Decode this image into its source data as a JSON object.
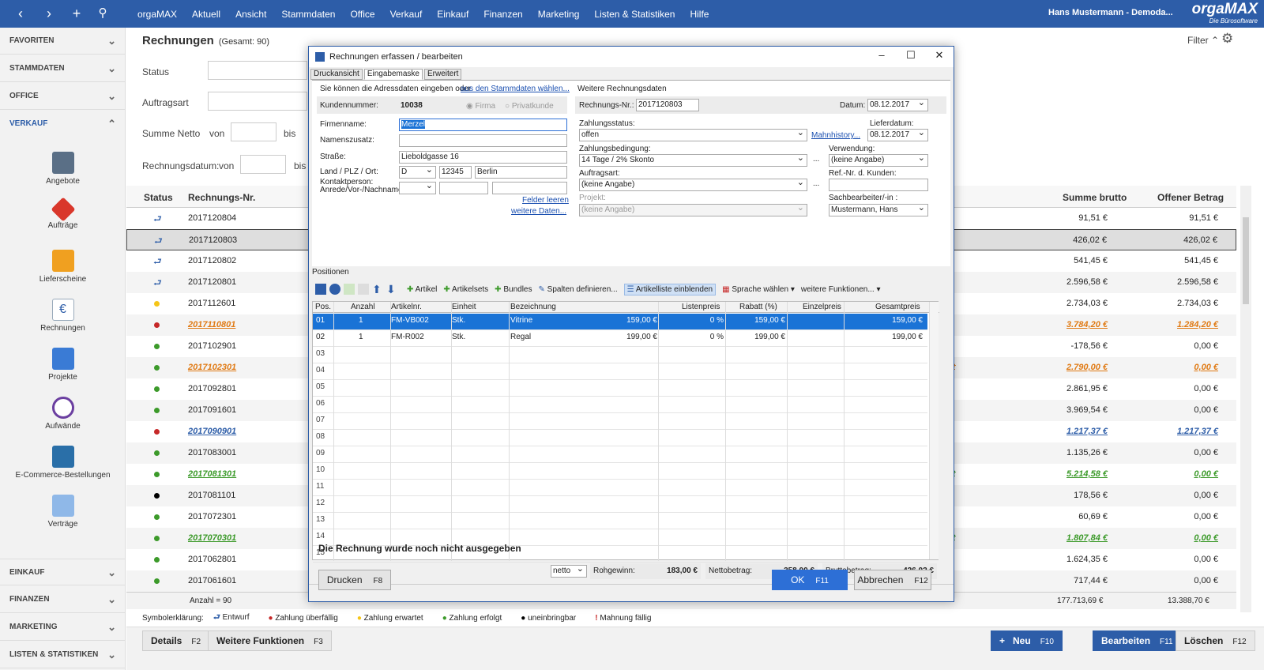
{
  "top": {
    "app": "orgaMAX",
    "menu": [
      "Aktuell",
      "Ansicht",
      "Stammdaten",
      "Office",
      "Verkauf",
      "Einkauf",
      "Finanzen",
      "Marketing",
      "Listen & Statistiken",
      "Hilfe"
    ],
    "user": "Hans Mustermann - Demoda...",
    "logo": "orgaMAX",
    "logo_sub": "Die Bürosoftware"
  },
  "sidebar": {
    "sections": [
      "FAVORITEN",
      "STAMMDATEN",
      "OFFICE",
      "VERKAUF"
    ],
    "items": [
      "Angebote",
      "Aufträge",
      "Lieferscheine",
      "Rechnungen",
      "Projekte",
      "Aufwände",
      "E-Commerce-Bestellungen",
      "Verträge"
    ],
    "bottom_sections": [
      "EINKAUF",
      "FINANZEN",
      "MARKETING",
      "LISTEN & STATISTIKEN"
    ]
  },
  "page": {
    "title": "Rechnungen",
    "count": "(Gesamt: 90)",
    "filter_label": "Filter",
    "f_status": "Status",
    "f_auftragsart": "Auftragsart",
    "f_summe": "Summe Netto",
    "f_von": "von",
    "f_bis": "bis",
    "f_datum": "Rechnungsdatum:",
    "f_datum_von": "von",
    "f_datum_bis": "bis"
  },
  "grid": {
    "col_status": "Status",
    "col_nr": "Rechnungs-Nr.",
    "col_brutto": "Summe brutto",
    "col_offen": "Offener Betrag",
    "rows": [
      {
        "nr": "2017120804",
        "brutto": "91,51 €",
        "offen": "91,51 €",
        "extra": "",
        "status": "draft"
      },
      {
        "nr": "2017120803",
        "brutto": "426,02 €",
        "offen": "426,02 €",
        "extra": "",
        "status": "draft"
      },
      {
        "nr": "2017120802",
        "brutto": "541,45 €",
        "offen": "541,45 €",
        "extra": "",
        "status": "draft"
      },
      {
        "nr": "2017120801",
        "brutto": "2.596,58 €",
        "offen": "2.596,58 €",
        "extra": "",
        "status": "draft"
      },
      {
        "nr": "2017112601",
        "brutto": "2.734,03 €",
        "offen": "2.734,03 €",
        "extra": "",
        "status": "yellow"
      },
      {
        "nr": "2017110801",
        "brutto": "3.784,20 €",
        "offen": "1.284,20 €",
        "extra": "t",
        "status": "red-orange"
      },
      {
        "nr": "2017102901",
        "brutto": "-178,56 €",
        "offen": "0,00 €",
        "extra": "alt",
        "status": "green"
      },
      {
        "nr": "2017102301",
        "brutto": "2.790,00 €",
        "offen": "0,00 €",
        "extra": "ahlt",
        "status": "green-orange"
      },
      {
        "nr": "2017092801",
        "brutto": "2.861,95 €",
        "offen": "0,00 €",
        "extra": "alt",
        "status": "green"
      },
      {
        "nr": "2017091601",
        "brutto": "3.969,54 €",
        "offen": "0,00 €",
        "extra": "alt",
        "status": "green"
      },
      {
        "nr": "2017090901",
        "brutto": "1.217,37 €",
        "offen": "1.217,37 €",
        "extra": "",
        "status": "red-blue"
      },
      {
        "nr": "2017083001",
        "brutto": "1.135,26 €",
        "offen": "0,00 €",
        "extra": "alt",
        "status": "green"
      },
      {
        "nr": "2017081301",
        "brutto": "5.214,58 €",
        "offen": "0,00 €",
        "extra": "ahlt",
        "status": "green-green"
      },
      {
        "nr": "2017081101",
        "brutto": "178,56 €",
        "offen": "0,00 €",
        "extra": "",
        "status": "black"
      },
      {
        "nr": "2017072301",
        "brutto": "60,69 €",
        "offen": "0,00 €",
        "extra": "alt",
        "status": "green"
      },
      {
        "nr": "2017070301",
        "brutto": "1.807,84 €",
        "offen": "0,00 €",
        "extra": "ahlt",
        "status": "green-green"
      },
      {
        "nr": "2017062801",
        "brutto": "1.624,35 €",
        "offen": "0,00 €",
        "extra": "alt",
        "status": "green"
      },
      {
        "nr": "2017061601",
        "brutto": "717,44 €",
        "offen": "0,00 €",
        "extra": "alt",
        "status": "green"
      }
    ],
    "anzahl": "Anzahl = 90",
    "sum_brutto": "177.713,69 €",
    "sum_offen": "13.388,70 €"
  },
  "legend": {
    "title": "Symbolerklärung:",
    "entwurf": "Entwurf",
    "ueberfaellig": "Zahlung überfällig",
    "erwartet": "Zahlung erwartet",
    "erfolgt": "Zahlung erfolgt",
    "uneinbringbar": "uneinbringbar",
    "mahnung": "Mahnung fällig"
  },
  "bottom": {
    "details": "Details",
    "details_key": "F2",
    "weitere": "Weitere Funktionen",
    "weitere_key": "F3",
    "neu": "Neu",
    "neu_key": "F10",
    "bearbeiten": "Bearbeiten",
    "bearbeiten_key": "F11",
    "loeschen": "Löschen",
    "loeschen_key": "F12"
  },
  "dialog": {
    "title": "Rechnungen erfassen / bearbeiten",
    "tabs": [
      "Druckansicht",
      "Eingabemaske",
      "Erweitert"
    ],
    "hint": "Sie können die Adressdaten eingeben oder",
    "hint_link": "aus den Stammdaten wählen...",
    "kundennr_label": "Kundennummer:",
    "kundennr": "10038",
    "firma": "Firma",
    "privat": "Privatkunde",
    "firmenname_label": "Firmenname:",
    "firmenname": "Merzel",
    "namenszusatz_label": "Namenszusatz:",
    "strasse_label": "Straße:",
    "strasse": "Lieboldgasse 16",
    "land_label": "Land / PLZ / Ort:",
    "land": "D",
    "plz": "12345",
    "ort": "Berlin",
    "kontakt_label1": "Kontaktperson:",
    "kontakt_label2": "Anrede/Vor-/Nachname",
    "felder_leeren": "Felder leeren",
    "weitere_daten": "weitere Daten...",
    "weitere_rd": "Weitere Rechnungsdaten",
    "rnr_label": "Rechnungs-Nr.:",
    "rnr": "2017120803",
    "datum_label": "Datum:",
    "datum": "08.12.2017",
    "zstatus_label": "Zahlungsstatus:",
    "zstatus": "offen",
    "mahnhistory": "Mahnhistory...",
    "lieferdatum_label": "Lieferdatum:",
    "lieferdatum": "08.12.2017",
    "zbed_label": "Zahlungsbedingung:",
    "zbed": "14 Tage / 2% Skonto",
    "verwendung_label": "Verwendung:",
    "verwendung": "(keine Angabe)",
    "auftragsart_label": "Auftragsart:",
    "auftragsart": "(keine Angabe)",
    "refnr_label": "Ref.-Nr. d. Kunden:",
    "projekt_label": "Projekt:",
    "projekt": "(keine Angabe)",
    "sachbearbeiter_label": "Sachbearbeiter/-in :",
    "sachbearbeiter": "Mustermann, Hans",
    "dots": "...",
    "positionen": "Positionen",
    "tb_artikel": "Artikel",
    "tb_artikelsets": "Artikelsets",
    "tb_bundles": "Bundles",
    "tb_spalten": "Spalten definieren...",
    "tb_artikelliste": "Artikelliste einblenden",
    "tb_sprache": "Sprache wählen",
    "tb_weitere": "weitere Funktionen...",
    "cols": [
      "Pos.",
      "Anzahl",
      "Artikelnr.",
      "Einheit",
      "Bezeichnung",
      "Listenpreis",
      "Rabatt (%)",
      "Einzelpreis",
      "Gesamtpreis"
    ],
    "positions": [
      {
        "pos": "01",
        "anzahl": "1",
        "artnr": "FM-VB002",
        "einheit": "Stk.",
        "bez": "Vitrine",
        "listen": "159,00 €",
        "rabatt": "0 %",
        "einzel": "159,00 €",
        "gesamt": "159,00 €"
      },
      {
        "pos": "02",
        "anzahl": "1",
        "artnr": "FM-R002",
        "einheit": "Stk.",
        "bez": "Regal",
        "listen": "199,00 €",
        "rabatt": "0 %",
        "einzel": "199,00 €",
        "gesamt": "199,00 €"
      }
    ],
    "empty_pos": [
      "03",
      "04",
      "05",
      "06",
      "07",
      "08",
      "09",
      "10",
      "11",
      "12",
      "13",
      "14",
      "15"
    ],
    "netto_sel": "netto",
    "rohgewinn_label": "Rohgewinn:",
    "rohgewinn": "183,00 €",
    "netto_label": "Nettobetrag:",
    "netto": "358,00 €",
    "brutto_label": "Bruttobetrag:",
    "brutto": "426,02 €",
    "notice": "Die Rechnung wurde noch nicht ausgegeben",
    "drucken": "Drucken",
    "drucken_key": "F8",
    "ok": "OK",
    "ok_key": "F11",
    "abbrechen": "Abbrechen",
    "abbrechen_key": "F12"
  },
  "colors": {
    "brand": "#2d5da8",
    "selection": "#1a73d6",
    "green": "#3c9a2a",
    "red": "#c62828",
    "orange": "#e07a14",
    "yellow": "#f5c518"
  }
}
